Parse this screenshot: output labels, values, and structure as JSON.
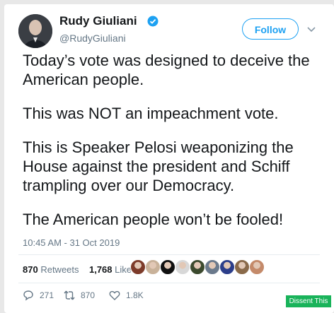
{
  "author": {
    "name": "Rudy Giuliani",
    "handle": "@RudyGiuliani",
    "verified_icon": "verified-badge-icon"
  },
  "follow_label": "Follow",
  "tweet": {
    "paragraphs": [
      "Today’s vote was designed to deceive the American people.",
      "This was NOT an impeachment vote.",
      "This is Speaker Pelosi weaponizing the House against the president and Schiff trampling over our Democracy.",
      "The American people won’t be fooled!"
    ],
    "timestamp": "10:45 AM - 31 Oct 2019"
  },
  "stats": {
    "retweets_count": "870",
    "retweets_label": "Retweets",
    "likes_count": "1,768",
    "likes_label": "Likes"
  },
  "liker_avatar_colors": [
    "#7d3b2a",
    "#c9b29a",
    "#111111",
    "#d8d8d8",
    "#3c4a2e",
    "#6b7a8c",
    "#2c3e8a",
    "#8a6a4a",
    "#c48a6a"
  ],
  "actions": {
    "reply_count": "271",
    "retweet_count": "870",
    "like_count": "1.8K"
  },
  "dissent_label": "Dissent This",
  "colors": {
    "accent": "#1da1f2",
    "dissent": "#19b35a"
  }
}
